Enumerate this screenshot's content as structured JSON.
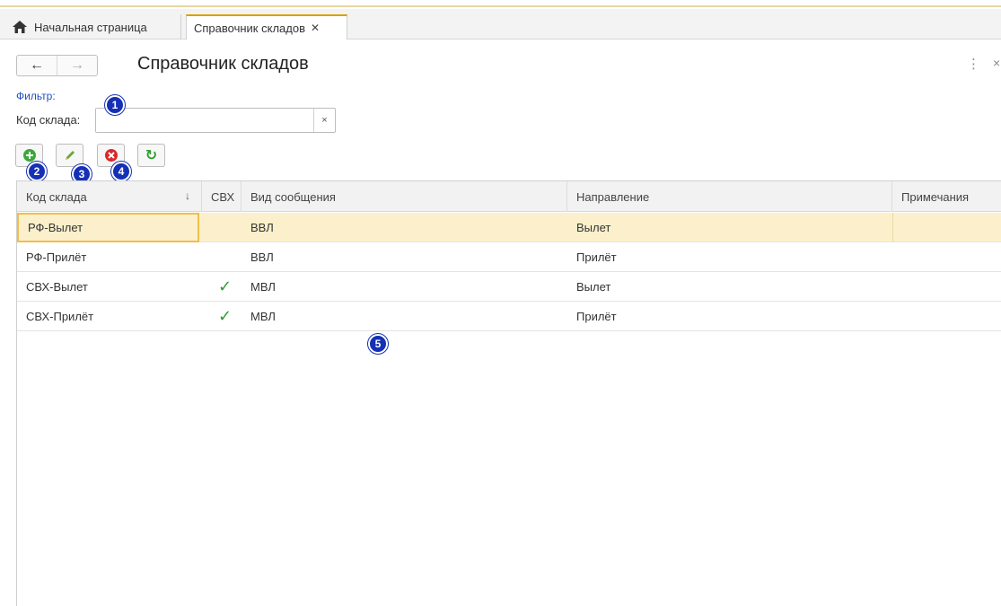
{
  "tabs": {
    "home_label": "Начальная страница",
    "active_label": "Справочник складов",
    "close_glyph": "✕"
  },
  "nav": {
    "back": "←",
    "forward": "→"
  },
  "page": {
    "title": "Справочник складов",
    "more_glyph": "⋮",
    "close_glyph": "×"
  },
  "filter": {
    "label": "Фильтр:",
    "code_label": "Код склада:",
    "code_value": "",
    "clear_glyph": "×"
  },
  "toolbar": {
    "add_icon": "plus-circle-icon",
    "edit_icon": "pencil-icon",
    "delete_icon": "x-circle-icon",
    "refresh_icon": "refresh-icon",
    "refresh_glyph": "↻"
  },
  "badges": [
    "1",
    "2",
    "3",
    "4",
    "5"
  ],
  "table": {
    "columns": [
      "Код склада",
      "СВХ",
      "Вид сообщения",
      "Направление",
      "Примечания"
    ],
    "sort_glyph": "↓",
    "check_glyph": "✓",
    "rows": [
      {
        "code": "РФ-Вылет",
        "svh": false,
        "type": "ВВЛ",
        "direction": "Вылет",
        "note": ""
      },
      {
        "code": "РФ-Прилёт",
        "svh": false,
        "type": "ВВЛ",
        "direction": "Прилёт",
        "note": ""
      },
      {
        "code": "СВХ-Вылет",
        "svh": true,
        "type": "МВЛ",
        "direction": "Вылет",
        "note": ""
      },
      {
        "code": "СВХ-Прилёт",
        "svh": true,
        "type": "МВЛ",
        "direction": "Прилёт",
        "note": ""
      }
    ]
  },
  "colors": {
    "accent_tab": "#d6a100",
    "selected_row": "#fbf0cb",
    "badge": "#1530b5",
    "check": "#2e9c2e",
    "filter_link": "#1f4fbf"
  }
}
